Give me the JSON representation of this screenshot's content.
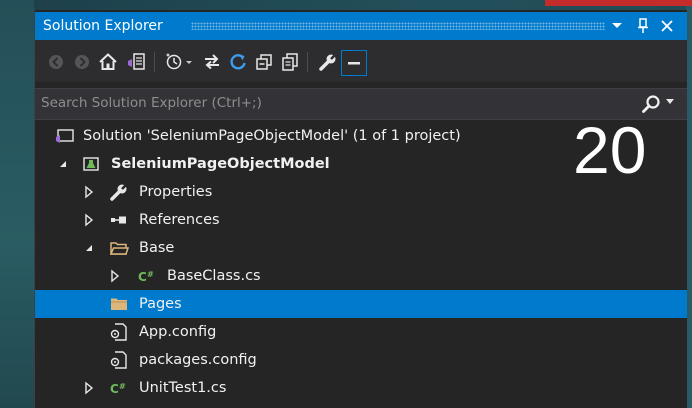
{
  "window": {
    "title": "Solution Explorer",
    "dropdown_icon": "chevron-down-icon",
    "pin_icon": "pin-icon",
    "close_icon": "close-icon"
  },
  "toolbar": {
    "tools": [
      {
        "name": "back-button",
        "icon": "back-arrow-icon"
      },
      {
        "name": "forward-button",
        "icon": "forward-arrow-icon"
      },
      {
        "name": "home-button",
        "icon": "home-icon"
      },
      {
        "name": "switch-views-button",
        "icon": "switch-views-icon"
      },
      {
        "name": "pending-changes-filter-button",
        "icon": "clock-filter-icon"
      },
      {
        "name": "sync-with-active-document-button",
        "icon": "sync-icon"
      },
      {
        "name": "refresh-button",
        "icon": "refresh-icon"
      },
      {
        "name": "collapse-all-button",
        "icon": "collapse-all-icon"
      },
      {
        "name": "show-all-files-button",
        "icon": "show-all-files-icon"
      },
      {
        "name": "properties-button",
        "icon": "wrench-icon"
      },
      {
        "name": "preview-selected-items-button",
        "icon": "preview-icon"
      }
    ]
  },
  "search": {
    "placeholder": "Search Solution Explorer (Ctrl+;)",
    "value": ""
  },
  "tree": {
    "items": [
      {
        "label": "Solution 'SeleniumPageObjectModel' (1 of 1 project)",
        "icon": "solution-icon",
        "expander": "none",
        "bold": false,
        "selected": false
      },
      {
        "label": "SeleniumPageObjectModel",
        "icon": "test-project-icon",
        "expander": "expanded",
        "bold": true,
        "selected": false
      },
      {
        "label": "Properties",
        "icon": "wrench-icon",
        "expander": "collapsed",
        "bold": false,
        "selected": false
      },
      {
        "label": "References",
        "icon": "references-icon",
        "expander": "collapsed",
        "bold": false,
        "selected": false
      },
      {
        "label": "Base",
        "icon": "folder-open-icon",
        "expander": "expanded",
        "bold": false,
        "selected": false
      },
      {
        "label": "BaseClass.cs",
        "icon": "csharp-file-icon",
        "expander": "collapsed",
        "bold": false,
        "selected": false
      },
      {
        "label": "Pages",
        "icon": "folder-icon",
        "expander": "none",
        "bold": false,
        "selected": true
      },
      {
        "label": "App.config",
        "icon": "config-file-icon",
        "expander": "none",
        "bold": false,
        "selected": false
      },
      {
        "label": "packages.config",
        "icon": "config-file-icon",
        "expander": "none",
        "bold": false,
        "selected": false
      },
      {
        "label": "UnitTest1.cs",
        "icon": "csharp-file-icon",
        "expander": "collapsed",
        "bold": false,
        "selected": false
      }
    ]
  },
  "overlay": {
    "number": "20"
  },
  "colors": {
    "accent": "#007acc",
    "panel": "#252526",
    "toolbar": "#2d2d30",
    "text": "#f1f1f1",
    "csharp": "#6fba5a",
    "folder": "#dcb67a",
    "vs_purple": "#9b6cd6"
  }
}
